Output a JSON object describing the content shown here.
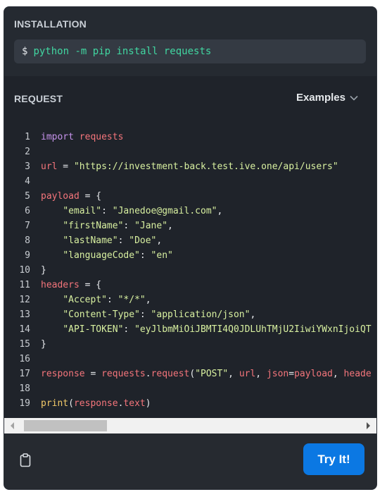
{
  "installation": {
    "label": "INSTALLATION",
    "prompt": "$",
    "command": "python -m pip install requests"
  },
  "request": {
    "label": "REQUEST",
    "examples_label": "Examples"
  },
  "code_lines": [
    {
      "n": "1",
      "tokens": [
        {
          "t": "import",
          "c": "kw"
        },
        {
          "t": " requests",
          "c": "var"
        }
      ]
    },
    {
      "n": "2",
      "tokens": []
    },
    {
      "n": "3",
      "tokens": [
        {
          "t": "url",
          "c": "var"
        },
        {
          "t": " = ",
          "c": "plain"
        },
        {
          "t": "\"https://investment-back.test.ive.one/api/users\"",
          "c": "str"
        }
      ]
    },
    {
      "n": "4",
      "tokens": []
    },
    {
      "n": "5",
      "tokens": [
        {
          "t": "payload",
          "c": "var"
        },
        {
          "t": " = {",
          "c": "plain"
        }
      ]
    },
    {
      "n": "6",
      "tokens": [
        {
          "t": "    ",
          "c": "plain"
        },
        {
          "t": "\"email\"",
          "c": "str"
        },
        {
          "t": ": ",
          "c": "plain"
        },
        {
          "t": "\"Janedoe@gmail.com\"",
          "c": "str"
        },
        {
          "t": ",",
          "c": "plain"
        }
      ]
    },
    {
      "n": "7",
      "tokens": [
        {
          "t": "    ",
          "c": "plain"
        },
        {
          "t": "\"firstName\"",
          "c": "str"
        },
        {
          "t": ": ",
          "c": "plain"
        },
        {
          "t": "\"Jane\"",
          "c": "str"
        },
        {
          "t": ",",
          "c": "plain"
        }
      ]
    },
    {
      "n": "8",
      "tokens": [
        {
          "t": "    ",
          "c": "plain"
        },
        {
          "t": "\"lastName\"",
          "c": "str"
        },
        {
          "t": ": ",
          "c": "plain"
        },
        {
          "t": "\"Doe\"",
          "c": "str"
        },
        {
          "t": ",",
          "c": "plain"
        }
      ]
    },
    {
      "n": "9",
      "tokens": [
        {
          "t": "    ",
          "c": "plain"
        },
        {
          "t": "\"languageCode\"",
          "c": "str"
        },
        {
          "t": ": ",
          "c": "plain"
        },
        {
          "t": "\"en\"",
          "c": "str"
        }
      ]
    },
    {
      "n": "10",
      "tokens": [
        {
          "t": "}",
          "c": "plain"
        }
      ]
    },
    {
      "n": "11",
      "tokens": [
        {
          "t": "headers",
          "c": "var"
        },
        {
          "t": " = {",
          "c": "plain"
        }
      ]
    },
    {
      "n": "12",
      "tokens": [
        {
          "t": "    ",
          "c": "plain"
        },
        {
          "t": "\"Accept\"",
          "c": "str"
        },
        {
          "t": ": ",
          "c": "plain"
        },
        {
          "t": "\"*/*\"",
          "c": "str"
        },
        {
          "t": ",",
          "c": "plain"
        }
      ]
    },
    {
      "n": "13",
      "tokens": [
        {
          "t": "    ",
          "c": "plain"
        },
        {
          "t": "\"Content-Type\"",
          "c": "str"
        },
        {
          "t": ": ",
          "c": "plain"
        },
        {
          "t": "\"application/json\"",
          "c": "str"
        },
        {
          "t": ",",
          "c": "plain"
        }
      ]
    },
    {
      "n": "14",
      "tokens": [
        {
          "t": "    ",
          "c": "plain"
        },
        {
          "t": "\"API-TOKEN\"",
          "c": "str"
        },
        {
          "t": ": ",
          "c": "plain"
        },
        {
          "t": "\"eyJlbmMiOiJBMTI4Q0JDLUhTMjU2IiwiYWxnIjoiQT",
          "c": "str"
        }
      ]
    },
    {
      "n": "15",
      "tokens": [
        {
          "t": "}",
          "c": "plain"
        }
      ]
    },
    {
      "n": "16",
      "tokens": []
    },
    {
      "n": "17",
      "tokens": [
        {
          "t": "response",
          "c": "var"
        },
        {
          "t": " = ",
          "c": "plain"
        },
        {
          "t": "requests",
          "c": "var"
        },
        {
          "t": ".",
          "c": "plain"
        },
        {
          "t": "request",
          "c": "var"
        },
        {
          "t": "(",
          "c": "plain"
        },
        {
          "t": "\"POST\"",
          "c": "str"
        },
        {
          "t": ", ",
          "c": "plain"
        },
        {
          "t": "url",
          "c": "var"
        },
        {
          "t": ", ",
          "c": "plain"
        },
        {
          "t": "json",
          "c": "var"
        },
        {
          "t": "=",
          "c": "plain"
        },
        {
          "t": "payload",
          "c": "var"
        },
        {
          "t": ", ",
          "c": "plain"
        },
        {
          "t": "heade",
          "c": "var"
        }
      ]
    },
    {
      "n": "18",
      "tokens": []
    },
    {
      "n": "19",
      "tokens": [
        {
          "t": "print",
          "c": "fn"
        },
        {
          "t": "(",
          "c": "plain"
        },
        {
          "t": "response",
          "c": "var"
        },
        {
          "t": ".",
          "c": "plain"
        },
        {
          "t": "text",
          "c": "var"
        },
        {
          "t": ")",
          "c": "plain"
        }
      ]
    }
  ],
  "footer": {
    "try_label": "Try It!",
    "clipboard_icon": "clipboard-icon"
  },
  "colors": {
    "accent": "#0b78e3",
    "command_text": "#41d6a1",
    "keyword": "#c693ec",
    "variable": "#f4757b",
    "string": "#d8f0a0",
    "function": "#f2c969"
  }
}
